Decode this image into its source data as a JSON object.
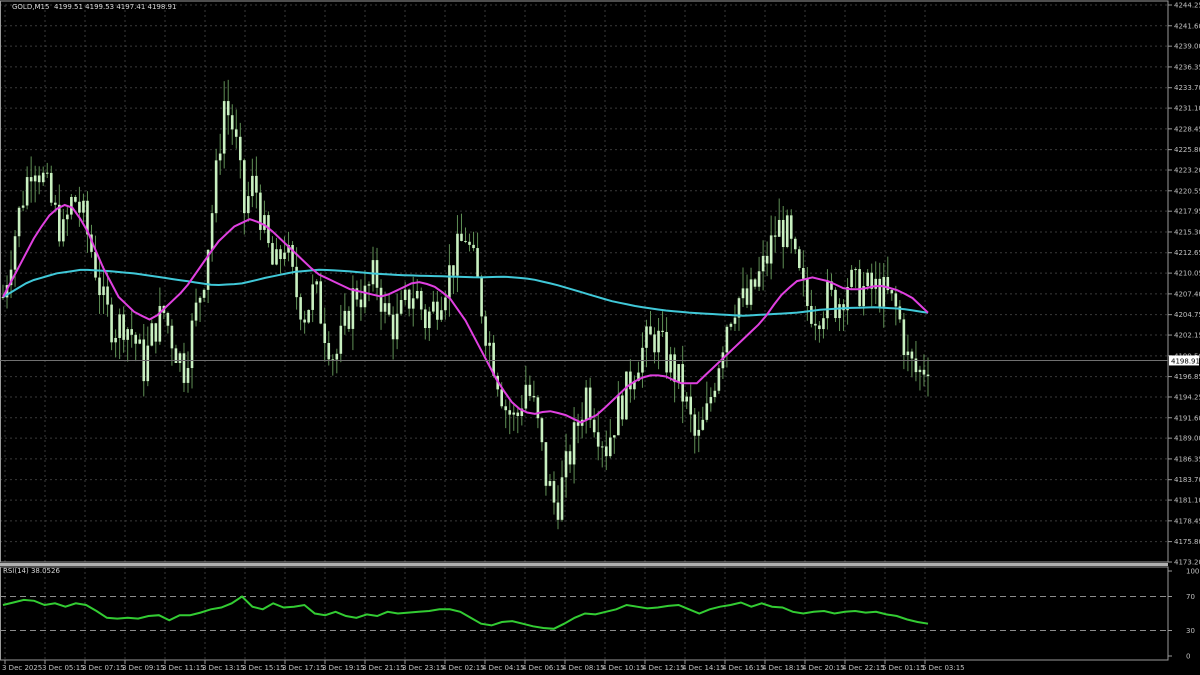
{
  "header": {
    "symbol_timeframe": "GOLD,M15",
    "ohlc": "4199.51 4199.53 4197.41 4198.91"
  },
  "rsi_header": {
    "label": "RSI(14) 38.0526"
  },
  "current_price_tag": "4198.91",
  "colors": {
    "background": "#000000",
    "grid": "#3a3a3a",
    "candle": "#c8f0c0",
    "wick": "#5f8f55",
    "ma_fast": "#e040e0",
    "ma_slow": "#40c8d8",
    "rsi_line": "#33cc33",
    "rsi_level": "#8c8c8c",
    "axis_text": "#c0c0c0"
  },
  "chart_data": [
    {
      "type": "candlestick",
      "title": "GOLD,M15",
      "y_ticks": [
        "4244.25",
        "4241.60",
        "4239.00",
        "4236.35",
        "4233.70",
        "4231.10",
        "4228.45",
        "4225.80",
        "4223.20",
        "4220.55",
        "4217.95",
        "4215.30",
        "4212.65",
        "4210.05",
        "4207.40",
        "4204.75",
        "4202.15",
        "4199.50",
        "4196.85",
        "4194.25",
        "4191.60",
        "4189.00",
        "4186.35",
        "4183.70",
        "4181.10",
        "4178.45",
        "4175.80",
        "4173.20"
      ],
      "ylim": [
        4173.2,
        4244.25
      ],
      "x_ticks": [
        "3 Dec 2025",
        "3 Dec 05:15",
        "3 Dec 07:15",
        "3 Dec 09:15",
        "3 Dec 11:15",
        "3 Dec 13:15",
        "3 Dec 15:15",
        "3 Dec 17:15",
        "3 Dec 19:15",
        "3 Dec 21:15",
        "3 Dec 23:15",
        "4 Dec 02:15",
        "4 Dec 04:15",
        "4 Dec 06:15",
        "4 Dec 08:15",
        "4 Dec 10:15",
        "4 Dec 12:15",
        "4 Dec 14:15",
        "4 Dec 16:15",
        "4 Dec 18:15",
        "4 Dec 20:15",
        "4 Dec 22:15",
        "5 Dec 01:15",
        "5 Dec 03:15"
      ],
      "close_path": [
        4207,
        4214,
        4220,
        4225,
        4222,
        4218,
        4215,
        4220,
        4217,
        4212,
        4206,
        4203,
        4204,
        4202,
        4198,
        4203,
        4205,
        4201,
        4198,
        4204,
        4210,
        4220,
        4232,
        4228,
        4218,
        4222,
        4215,
        4210,
        4214,
        4208,
        4205,
        4208,
        4203,
        4199,
        4203,
        4208,
        4207,
        4210,
        4205,
        4203,
        4206,
        4208,
        4204,
        4206,
        4209,
        4212,
        4215,
        4210,
        4203,
        4198,
        4193,
        4191,
        4196,
        4192,
        4184,
        4180,
        4185,
        4190,
        4195,
        4191,
        4188,
        4192,
        4195,
        4199,
        4201,
        4202,
        4199,
        4197,
        4193,
        4188,
        4192,
        4198,
        4204,
        4207,
        4206,
        4209,
        4212,
        4216,
        4215,
        4210,
        4206,
        4205,
        4207,
        4206,
        4209,
        4208,
        4208,
        4208,
        4207,
        4205,
        4199,
        4197,
        4198.91
      ],
      "ma_fast": [
        4207,
        4211,
        4215,
        4218,
        4219,
        4216,
        4211,
        4207,
        4205,
        4204,
        4206,
        4208,
        4211,
        4214,
        4216,
        4217,
        4216,
        4214,
        4212,
        4210,
        4209,
        4208,
        4207.5,
        4207,
        4208,
        4209,
        4208.5,
        4207,
        4204,
        4200,
        4196,
        4193,
        4192,
        4192.5,
        4192,
        4191,
        4192,
        4194,
        4196,
        4197,
        4197,
        4196,
        4196,
        4198,
        4200,
        4202,
        4204,
        4207,
        4209,
        4209.5,
        4209,
        4208,
        4208,
        4208.5,
        4208,
        4207,
        4205
      ],
      "ma_slow": [
        4207,
        4209,
        4210,
        4210.5,
        4210.3,
        4210,
        4209.5,
        4209,
        4208.5,
        4208.7,
        4209.5,
        4210.2,
        4210.5,
        4210.3,
        4210,
        4209.8,
        4209.7,
        4209.6,
        4209.5,
        4209.6,
        4209.3,
        4208.5,
        4207.5,
        4206.5,
        4205.8,
        4205.3,
        4205,
        4204.8,
        4204.6,
        4204.8,
        4205,
        4205.4,
        4205.6,
        4205.7,
        4205.5,
        4205
      ]
    },
    {
      "type": "line",
      "title": "RSI(14) 38.0526",
      "series": [
        {
          "values": [
            60,
            63,
            66,
            65,
            60,
            62,
            58,
            62,
            60,
            53,
            45,
            44,
            45,
            44,
            47,
            48,
            42,
            48,
            48,
            51,
            55,
            57,
            62,
            70,
            58,
            55,
            62,
            57,
            58,
            60,
            50,
            48,
            52,
            47,
            45,
            49,
            47,
            52,
            50,
            51,
            52,
            53,
            55,
            55,
            52,
            45,
            38,
            36,
            40,
            41,
            38,
            35,
            33,
            32,
            38,
            45,
            50,
            49,
            52,
            55,
            60,
            58,
            56,
            57,
            59,
            60,
            55,
            50,
            55,
            58,
            60,
            63,
            58,
            62,
            58,
            57,
            52,
            50,
            52,
            53,
            50,
            52,
            53,
            51,
            52,
            49,
            47,
            43,
            40,
            38.05
          ]
        }
      ],
      "levels": [
        70,
        30
      ],
      "y_ticks": [
        "100",
        "70",
        "30",
        "0"
      ],
      "ylim": [
        0,
        100
      ]
    }
  ]
}
